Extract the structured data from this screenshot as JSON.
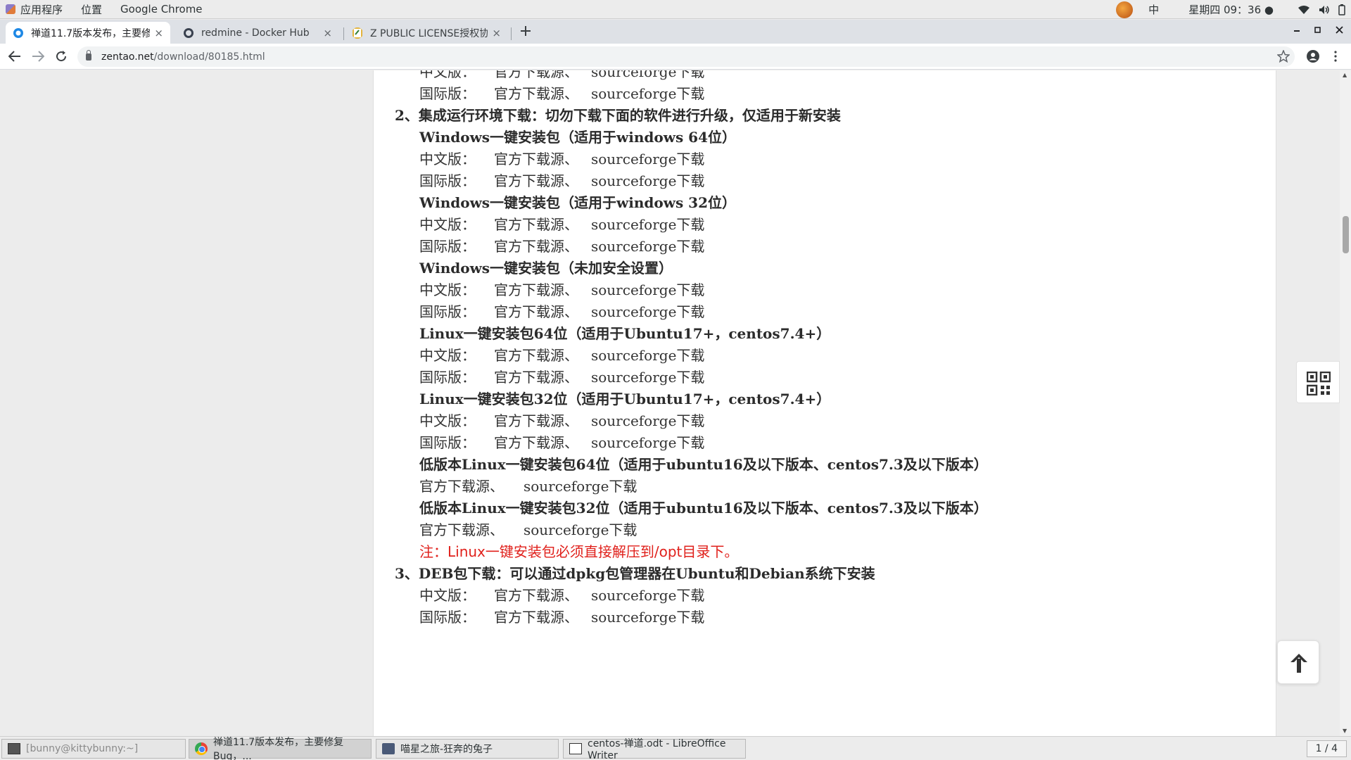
{
  "topbar": {
    "applications": "应用程序",
    "places": "位置",
    "app_name": "Google Chrome",
    "ime": "中",
    "clock": "星期四 09：36 ●"
  },
  "tabs": [
    {
      "title": "禅道11.7版本发布，主要修",
      "close": "×",
      "favicon_color": "#1e88e5"
    },
    {
      "title": "redmine - Docker Hub",
      "close": "×",
      "favicon_color": "#39414f"
    },
    {
      "title": "Z PUBLIC LICENSE授权协议",
      "close": "×",
      "favicon_color": "#e0a100"
    }
  ],
  "toolbar": {
    "url_host": "zentao.net",
    "url_path": "/download/80185.html"
  },
  "page": {
    "partial_top": {
      "label": "中文版：",
      "src1": "官方下载源、",
      "src2": "sourceforge下载"
    },
    "first_intl": {
      "label": "国际版：",
      "src1": "官方下载源、",
      "src2": "sourceforge下载"
    },
    "section2": "2、集成运行环境下载：切勿下载下面的软件进行升级，仅适用于新安装",
    "packages": [
      {
        "title": "Windows一键安装包（适用于windows 64位）",
        "cn": {
          "label": "中文版：",
          "src1": "官方下载源、",
          "src2": "sourceforge下载"
        },
        "intl": {
          "label": "国际版：",
          "src1": "官方下载源、",
          "src2": "sourceforge下载"
        }
      },
      {
        "title": "Windows一键安装包（适用于windows 32位）",
        "cn": {
          "label": "中文版：",
          "src1": "官方下载源、",
          "src2": "sourceforge下载"
        },
        "intl": {
          "label": "国际版：",
          "src1": "官方下载源、",
          "src2": "sourceforge下载"
        }
      },
      {
        "title": "Windows一键安装包（未加安全设置）",
        "cn": {
          "label": "中文版：",
          "src1": "官方下载源、",
          "src2": "sourceforge下载"
        },
        "intl": {
          "label": "国际版：",
          "src1": "官方下载源、",
          "src2": "sourceforge下载"
        }
      },
      {
        "title": "Linux一键安装包64位（适用于Ubuntu17+，centos7.4+）",
        "cn": {
          "label": "中文版：",
          "src1": "官方下载源、",
          "src2": "sourceforge下载"
        },
        "intl": {
          "label": "国际版：",
          "src1": "官方下载源、",
          "src2": "sourceforge下载"
        }
      },
      {
        "title": "Linux一键安装包32位（适用于Ubuntu17+，centos7.4+）",
        "cn": {
          "label": "中文版：",
          "src1": "官方下载源、",
          "src2": "sourceforge下载"
        },
        "intl": {
          "label": "国际版：",
          "src1": "官方下载源、",
          "src2": "sourceforge下载"
        }
      }
    ],
    "legacy": [
      {
        "title": "低版本Linux一键安装包64位（适用于ubuntu16及以下版本、centos7.3及以下版本）",
        "src1": "官方下载源、",
        "src2": "sourceforge下载"
      },
      {
        "title": "低版本Linux一键安装包32位（适用于ubuntu16及以下版本、centos7.3及以下版本）",
        "src1": "官方下载源、",
        "src2": "sourceforge下载"
      }
    ],
    "note": "注：Linux一键安装包必须直接解压到/opt目录下。",
    "section3": "3、DEB包下载：可以通过dpkg包管理器在Ubuntu和Debian系统下安装",
    "deb_cn": {
      "label": "中文版：",
      "src1": "官方下载源、",
      "src2": "sourceforge下载"
    },
    "deb_intl_partial": {
      "label": "国际版：",
      "src1": "官方下载源、",
      "src2": "sourceforge下载"
    }
  },
  "taskbar": {
    "items": [
      {
        "title": "[bunny@kittybunny:~]"
      },
      {
        "title": "禅道11.7版本发布，主要修复Bug，..."
      },
      {
        "title": "喵星之旅-狂奔的兔子"
      },
      {
        "title": "centos-禅道.odt - LibreOffice Writer"
      }
    ],
    "workspace": "1 / 4"
  },
  "colors": {
    "note_red": "#e0201b",
    "body_text": "#333333"
  }
}
